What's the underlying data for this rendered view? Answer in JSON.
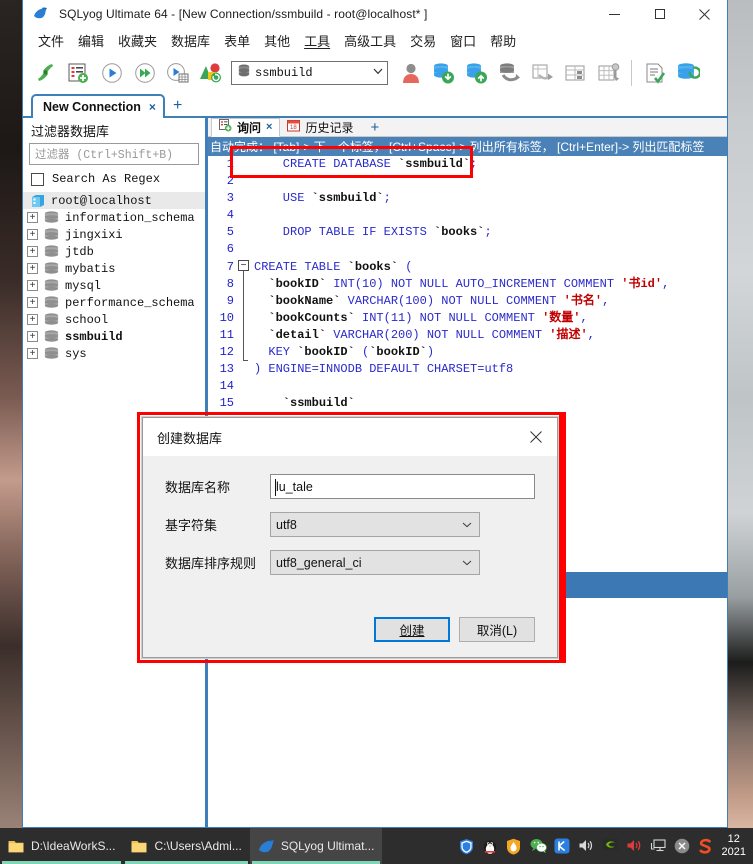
{
  "window": {
    "title": "SQLyog Ultimate 64 - [New Connection/ssmbuild - root@localhost* ]",
    "app_icon": "dolphin-icon",
    "minimize_label": "Minimize",
    "maximize_label": "Maximize",
    "close_label": "Close"
  },
  "menubar": {
    "items": [
      {
        "label": "文件"
      },
      {
        "label": "编辑"
      },
      {
        "label": "收藏夹"
      },
      {
        "label": "数据库"
      },
      {
        "label": "表单"
      },
      {
        "label": "其他"
      },
      {
        "label": "工具",
        "underlined": true
      },
      {
        "label": "高级工具"
      },
      {
        "label": "交易"
      },
      {
        "label": "窗口"
      },
      {
        "label": "帮助"
      }
    ]
  },
  "toolbar": {
    "buttons": [
      {
        "name": "new-connection-icon"
      },
      {
        "name": "new-query-tab-icon"
      },
      {
        "name": "execute-query-icon"
      },
      {
        "name": "execute-all-queries-icon"
      },
      {
        "name": "execute-query-to-grid-icon"
      },
      {
        "name": "refresh-object-browser-icon"
      }
    ],
    "db_combo": {
      "value": "ssmbuild",
      "icon": "database-icon",
      "arrow": "chevron-down-icon"
    },
    "buttons_right": [
      {
        "name": "user-manager-icon"
      },
      {
        "name": "import-database-icon"
      },
      {
        "name": "export-database-icon"
      },
      {
        "name": "backup-database-icon"
      },
      {
        "name": "copy-table-icon"
      },
      {
        "name": "table-data-icon"
      },
      {
        "name": "manage-index-icon"
      },
      {
        "name": "query-builder-icon"
      },
      {
        "name": "sync-database-icon"
      }
    ]
  },
  "connection_tabs": {
    "tabs": [
      {
        "label": "New Connection",
        "close": "×",
        "active": true
      }
    ],
    "add_label": "+"
  },
  "sidebar": {
    "header": "过滤器数据库",
    "filter_placeholder": "过滤器 (Ctrl+Shift+B)",
    "filter_value": "",
    "regex_label": "Search As Regex",
    "regex_checked": false,
    "tree": [
      {
        "label": "root@localhost",
        "type": "server",
        "expanded": true,
        "selected": true,
        "bold": false
      },
      {
        "label": "information_schema",
        "type": "database",
        "expanded": false,
        "bold": false
      },
      {
        "label": "jingxixi",
        "type": "database",
        "expanded": false,
        "bold": false
      },
      {
        "label": "jtdb",
        "type": "database",
        "expanded": false,
        "bold": false
      },
      {
        "label": "mybatis",
        "type": "database",
        "expanded": false,
        "bold": false
      },
      {
        "label": "mysql",
        "type": "database",
        "expanded": false,
        "bold": false
      },
      {
        "label": "performance_schema",
        "type": "database",
        "expanded": false,
        "bold": false
      },
      {
        "label": "school",
        "type": "database",
        "expanded": false,
        "bold": false
      },
      {
        "label": "ssmbuild",
        "type": "database",
        "expanded": false,
        "bold": true
      },
      {
        "label": "sys",
        "type": "database",
        "expanded": false,
        "bold": false
      }
    ]
  },
  "editor": {
    "tabs": [
      {
        "label": "询问",
        "icon": "query-icon",
        "active": true,
        "close": "×"
      },
      {
        "label": "历史记录",
        "icon": "calendar-icon",
        "active": false
      }
    ],
    "add_tab_label": "+",
    "hint": {
      "prefix": "自动完成：",
      "parts": [
        {
          "key": "[Tab]",
          "text": "-> 下一个标签，"
        },
        {
          "key": "[Ctrl+Space]",
          "text": "-> 列出所有标签，"
        },
        {
          "key": "[Ctrl+Enter]",
          "text": "-> 列出匹配标签"
        }
      ],
      "full": "自动完成： [Tab]-> 下一个标签， [Ctrl+Space]-> 列出所有标签， [Ctrl+Enter]-> 列出匹配标签"
    },
    "lines": [
      {
        "n": 1,
        "text": "    CREATE DATABASE `ssmbuild`;"
      },
      {
        "n": 2,
        "text": ""
      },
      {
        "n": 3,
        "text": "    USE `ssmbuild`;"
      },
      {
        "n": 4,
        "text": ""
      },
      {
        "n": 5,
        "text": "    DROP TABLE IF EXISTS `books`;"
      },
      {
        "n": 6,
        "text": ""
      },
      {
        "n": 7,
        "text": "CREATE TABLE `books` ("
      },
      {
        "n": 8,
        "text": "  `bookID` INT(10) NOT NULL AUTO_INCREMENT COMMENT '书id',"
      },
      {
        "n": 9,
        "text": "  `bookName` VARCHAR(100) NOT NULL COMMENT '书名',"
      },
      {
        "n": 10,
        "text": "  `bookCounts` INT(11) NOT NULL COMMENT '数量',"
      },
      {
        "n": 11,
        "text": "  `detail` VARCHAR(200) NOT NULL COMMENT '描述',"
      },
      {
        "n": 12,
        "text": "  KEY `bookID` (`bookID`)"
      },
      {
        "n": 13,
        "text": ") ENGINE=INNODB DEFAULT CHARSET=utf8"
      },
      {
        "n": 14,
        "text": ""
      },
      {
        "n": 15,
        "text": "    `ssmbuild`"
      }
    ]
  },
  "dialog": {
    "title": "创建数据库",
    "close_label": "×",
    "fields": [
      {
        "label": "数据库名称",
        "type": "text",
        "value": "lu_tale"
      },
      {
        "label": "基字符集",
        "type": "select",
        "value": "utf8"
      },
      {
        "label": "数据库排序规则",
        "type": "select",
        "value": "utf8_general_ci"
      }
    ],
    "buttons": [
      {
        "label": "创建",
        "primary": true
      },
      {
        "label": "取消(L)",
        "primary": false,
        "accel": "L"
      }
    ]
  },
  "taskbar": {
    "tasks": [
      {
        "label": "D:\\IdeaWorkS...",
        "icon": "folder-icon",
        "active": false
      },
      {
        "label": "C:\\Users\\Admi...",
        "icon": "folder-icon",
        "active": false
      },
      {
        "label": "SQLyog Ultimat...",
        "icon": "dolphin-icon",
        "active": true
      }
    ],
    "tray": [
      {
        "name": "tencent-pc-manager-icon"
      },
      {
        "name": "qq-penguin-icon"
      },
      {
        "name": "shield-flame-icon"
      },
      {
        "name": "wechat-icon"
      },
      {
        "name": "kugou-icon"
      },
      {
        "name": "volume-icon"
      },
      {
        "name": "nvidia-icon"
      },
      {
        "name": "speaker-icon"
      },
      {
        "name": "network-icon"
      },
      {
        "name": "close-circle-icon"
      },
      {
        "name": "sogou-input-icon"
      }
    ],
    "clock_time": "12",
    "clock_date": "2021"
  },
  "annotations": {
    "highlight_color": "#ff0000"
  }
}
